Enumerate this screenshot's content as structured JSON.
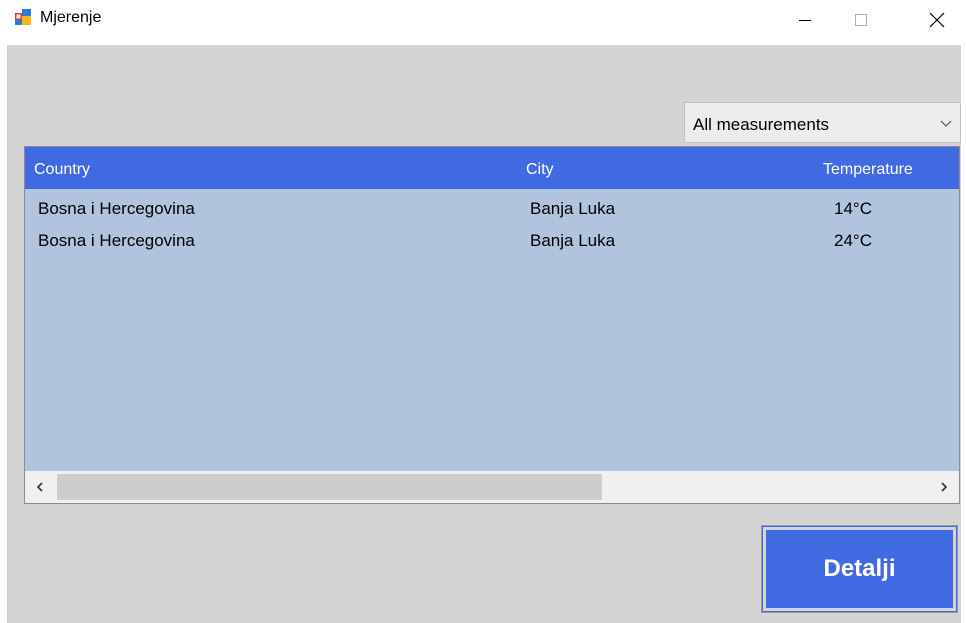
{
  "window": {
    "title": "Mjerenje",
    "app_icon": "winforms-app-icon",
    "controls": {
      "minimize": "minimize-icon",
      "maximize": "maximize-icon",
      "close": "close-icon"
    }
  },
  "filter": {
    "selected": "All measurements",
    "icon": "chevron-down-icon"
  },
  "table": {
    "columns": [
      "Country",
      "City",
      "Temperature"
    ],
    "rows": [
      {
        "country": "Bosna i Hercegovina",
        "city": "Banja Luka",
        "temperature": "14°C"
      },
      {
        "country": "Bosna i Hercegovina",
        "city": "Banja Luka",
        "temperature": "24°C"
      }
    ],
    "scrollbar": {
      "left_icon": "chevron-left-icon",
      "right_icon": "chevron-right-icon"
    }
  },
  "actions": {
    "details_label": "Detalji"
  },
  "colors": {
    "window_bg": "#d4d4d4",
    "accent": "#4169e1",
    "list_bg": "#b0c4de",
    "header_text": "#ffffff"
  }
}
